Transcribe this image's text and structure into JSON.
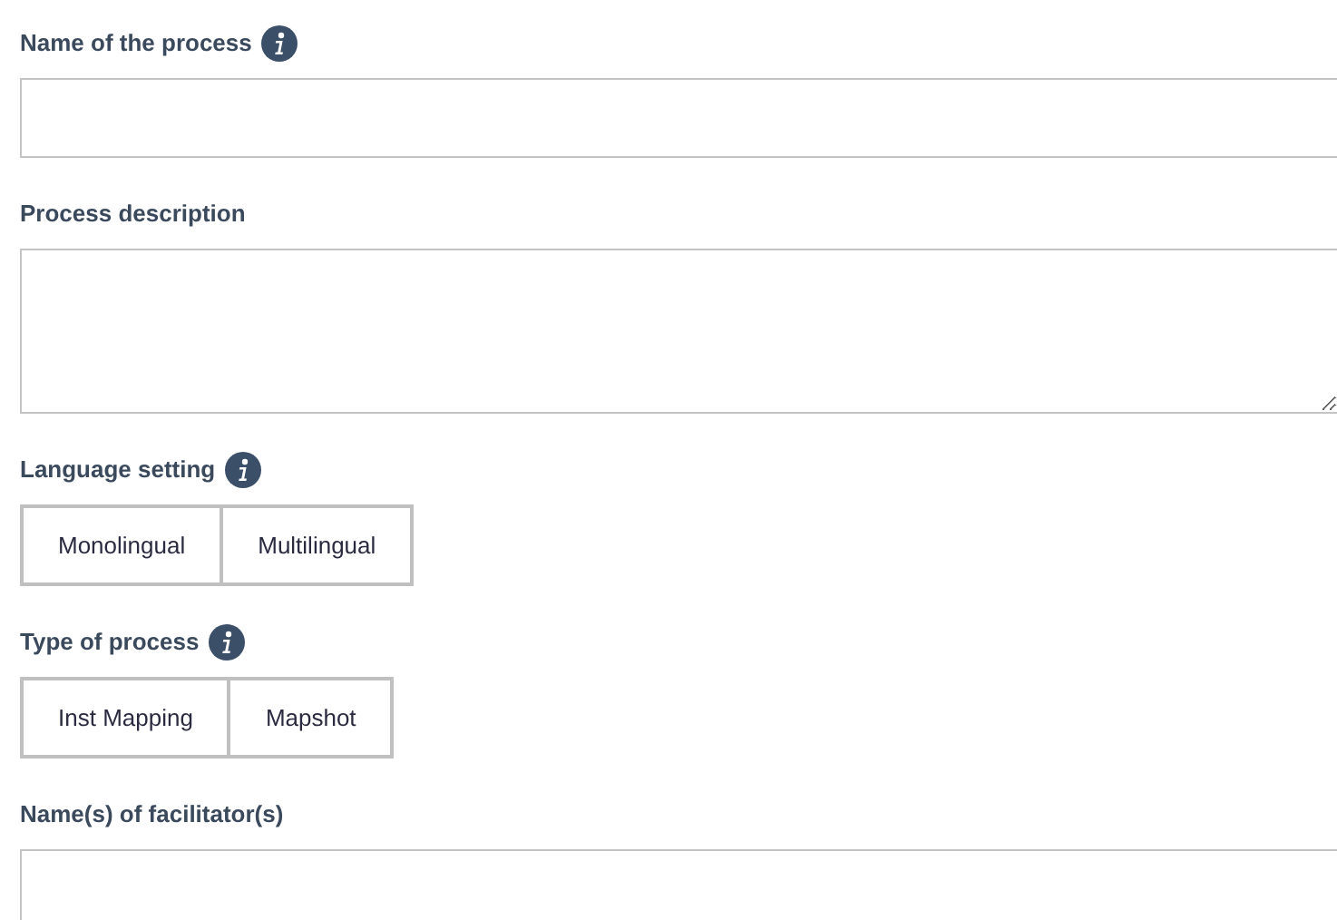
{
  "fields": [
    {
      "kind": "text",
      "label": "Name of the process",
      "info": true
    },
    {
      "kind": "textarea",
      "label": "Process description"
    },
    {
      "kind": "choice",
      "label": "Language setting",
      "info": true,
      "options": [
        "Monolingual",
        "Multilingual"
      ]
    },
    {
      "kind": "choice",
      "label": "Type of process",
      "info": true,
      "options": [
        "Inst Mapping",
        "Mapshot"
      ]
    },
    {
      "kind": "text",
      "label": "Name(s) of facilitator(s)"
    }
  ]
}
